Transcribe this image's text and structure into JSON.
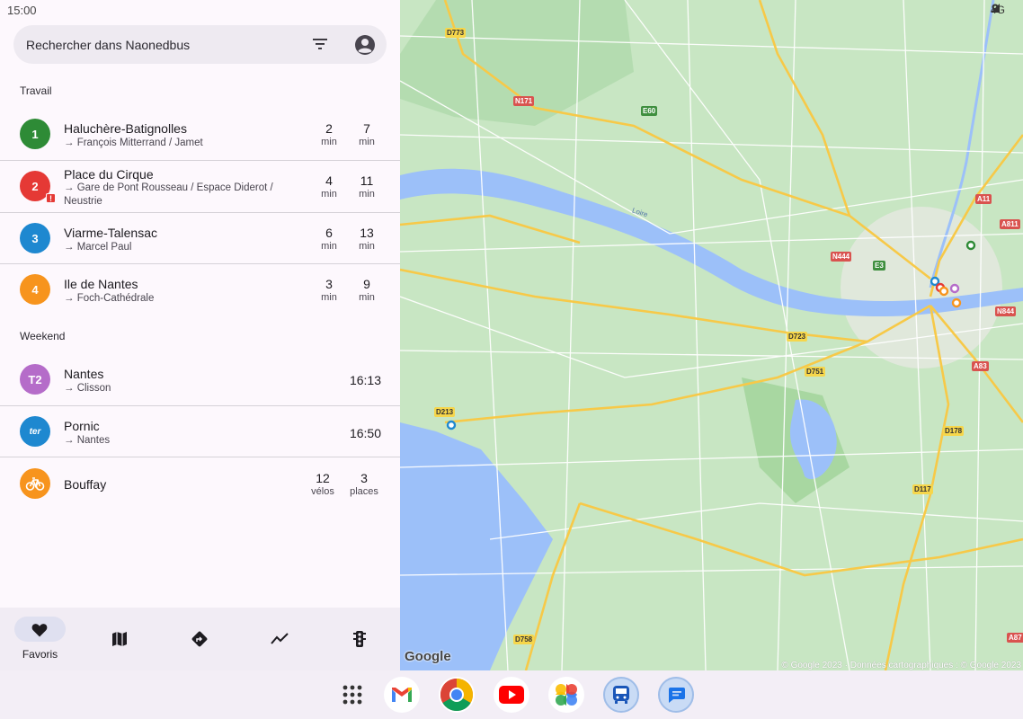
{
  "status_bar": {
    "time": "15:00",
    "network": "4G"
  },
  "search": {
    "placeholder": "Rechercher dans Naonedbus"
  },
  "sections": [
    {
      "title": "Travail",
      "items": [
        {
          "badge": "1",
          "color": "#2e8b36",
          "stop": "Haluchère-Batignolles",
          "destination": "→ François Mitterrand / Jamet",
          "alert": false,
          "times": [
            {
              "value": "2",
              "unit": "min"
            },
            {
              "value": "7",
              "unit": "min"
            }
          ]
        },
        {
          "badge": "2",
          "color": "#e53935",
          "stop": "Place du Cirque",
          "destination": "→ Gare de Pont Rousseau / Espace Diderot / Neustrie",
          "alert": true,
          "alert_mark": "!",
          "times": [
            {
              "value": "4",
              "unit": "min"
            },
            {
              "value": "11",
              "unit": "min"
            }
          ]
        },
        {
          "badge": "3",
          "color": "#1e88d0",
          "stop": "Viarme-Talensac",
          "destination": "→ Marcel Paul",
          "alert": false,
          "times": [
            {
              "value": "6",
              "unit": "min"
            },
            {
              "value": "13",
              "unit": "min"
            }
          ]
        },
        {
          "badge": "4",
          "color": "#f7941d",
          "stop": "Ile de Nantes",
          "destination": "→ Foch-Cathédrale",
          "alert": false,
          "times": [
            {
              "value": "3",
              "unit": "min"
            },
            {
              "value": "9",
              "unit": "min"
            }
          ]
        }
      ]
    },
    {
      "title": "Weekend",
      "items": [
        {
          "badge": "T2",
          "color": "#b56cc9",
          "stop": "Nantes",
          "destination": "→ Clisson",
          "clock": "16:13"
        },
        {
          "badge": "ter",
          "color": "#1e88d0",
          "stop": "Pornic",
          "destination": "→ Nantes",
          "clock": "16:50"
        },
        {
          "badge": "bike",
          "color": "#f7941d",
          "stop": "Bouffay",
          "destination": "",
          "times": [
            {
              "value": "12",
              "unit": "vélos"
            },
            {
              "value": "3",
              "unit": "places"
            }
          ]
        }
      ]
    }
  ],
  "nav": {
    "favorites_label": "Favoris"
  },
  "map": {
    "logo": "Google",
    "copyright": "© Google 2023 · Données cartographiques : © Google 2023",
    "river_label": "Loire",
    "road_labels": [
      "D773",
      "N171",
      "E60",
      "A11",
      "A811",
      "N444",
      "E3",
      "N844",
      "D723",
      "D751",
      "A83",
      "D213",
      "D178",
      "D117",
      "D758",
      "A87"
    ]
  },
  "dock": {
    "apps": [
      "app-drawer",
      "gmail",
      "chrome",
      "youtube",
      "photos",
      "naonedbus",
      "messages"
    ]
  }
}
